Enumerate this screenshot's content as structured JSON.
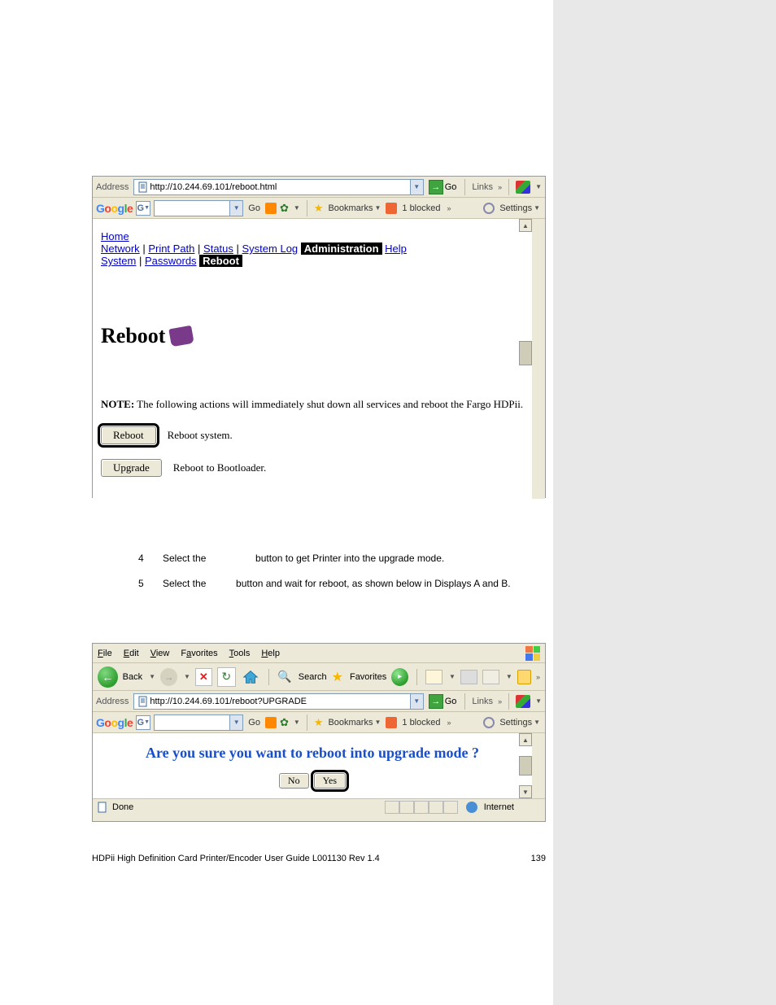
{
  "shot1": {
    "addr_label": "Address",
    "url": "http://10.244.69.101/reboot.html",
    "go_label": "Go",
    "links_label": "Links",
    "gbar": {
      "go": "Go",
      "bookmarks": "Bookmarks",
      "blocked": "1 blocked",
      "settings": "Settings"
    },
    "nav": {
      "home": "Home",
      "network": "Network",
      "print_path": "Print Path",
      "status": "Status",
      "system_log": "System Log",
      "administration": "Administration",
      "help": "Help",
      "system": "System",
      "passwords": "Passwords",
      "reboot": "Reboot"
    },
    "title": "Reboot",
    "note_bold": "NOTE:",
    "note_rest": " The following actions will immediately shut down all services and reboot the Fargo HDPii.",
    "btn_reboot": "Reboot",
    "desc_reboot": "Reboot system.",
    "btn_upgrade": "Upgrade",
    "desc_upgrade": "Reboot to Bootloader."
  },
  "steps": {
    "s4n": "4",
    "s4a": "Select the ",
    "s4b": " button to get Printer into the upgrade mode.",
    "s5n": "5",
    "s5a": "Select the ",
    "s5b": " button and wait for reboot, as shown below in Displays A and B."
  },
  "shot2": {
    "menus": {
      "file": "File",
      "edit": "Edit",
      "view": "View",
      "fav": "Favorites",
      "tools": "Tools",
      "help": "Help"
    },
    "back": "Back",
    "search": "Search",
    "favorites": "Favorites",
    "addr_label": "Address",
    "url": "http://10.244.69.101/reboot?UPGRADE",
    "go_label": "Go",
    "links_label": "Links",
    "gbar": {
      "go": "Go",
      "bookmarks": "Bookmarks",
      "blocked": "1 blocked",
      "settings": "Settings"
    },
    "question": "Are you sure you want to reboot into upgrade mode ?",
    "no": "No",
    "yes": "Yes",
    "status_done": "Done",
    "status_zone": "Internet"
  },
  "footer": {
    "left": "HDPii High Definition Card Printer/Encoder User Guide    L001130 Rev 1.4",
    "right": "139"
  }
}
